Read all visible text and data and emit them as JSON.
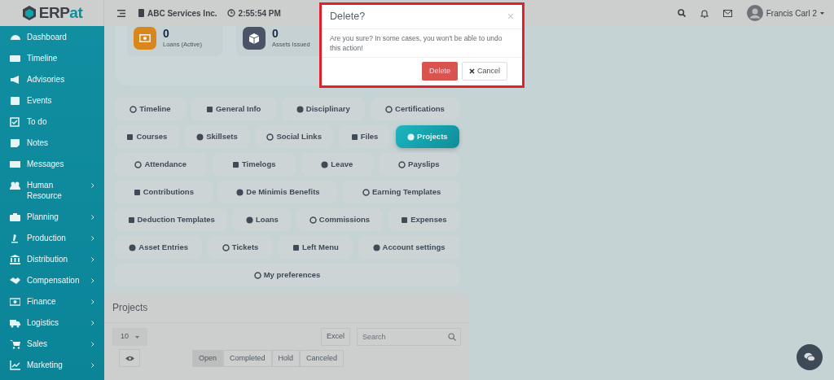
{
  "header": {
    "logo": {
      "main": "ERP",
      "accent": "at"
    },
    "company": "ABC Services Inc.",
    "time": "2:55:54 PM",
    "user": "Francis Carl 2"
  },
  "sidebar": {
    "items": [
      {
        "label": "Dashboard",
        "has_submenu": false
      },
      {
        "label": "Timeline",
        "has_submenu": false
      },
      {
        "label": "Advisories",
        "has_submenu": false
      },
      {
        "label": "Events",
        "has_submenu": false
      },
      {
        "label": "To do",
        "has_submenu": false
      },
      {
        "label": "Notes",
        "has_submenu": false
      },
      {
        "label": "Messages",
        "has_submenu": false
      },
      {
        "label": "Human Resource",
        "has_submenu": true
      },
      {
        "label": "Planning",
        "has_submenu": true
      },
      {
        "label": "Production",
        "has_submenu": true
      },
      {
        "label": "Distribution",
        "has_submenu": true
      },
      {
        "label": "Compensation",
        "has_submenu": true
      },
      {
        "label": "Finance",
        "has_submenu": true
      },
      {
        "label": "Logistics",
        "has_submenu": true
      },
      {
        "label": "Sales",
        "has_submenu": true
      },
      {
        "label": "Marketing",
        "has_submenu": true
      }
    ]
  },
  "stats": [
    {
      "value": "0",
      "label": "Loans (Active)",
      "color": "#d9861c"
    },
    {
      "value": "0",
      "label": "Assets Issued",
      "color": "#4a5466"
    }
  ],
  "profile_tabs": [
    [
      {
        "label": "Timeline",
        "selected": false
      },
      {
        "label": "General Info",
        "selected": false
      },
      {
        "label": "Disciplinary",
        "selected": false
      },
      {
        "label": "Certifications",
        "selected": false
      }
    ],
    [
      {
        "label": "Courses",
        "selected": false
      },
      {
        "label": "Skillsets",
        "selected": false
      },
      {
        "label": "Social Links",
        "selected": false
      },
      {
        "label": "Files",
        "selected": false
      },
      {
        "label": "Projects",
        "selected": true
      }
    ],
    [
      {
        "label": "Attendance",
        "selected": false
      },
      {
        "label": "Timelogs",
        "selected": false
      },
      {
        "label": "Leave",
        "selected": false
      },
      {
        "label": "Payslips",
        "selected": false
      }
    ],
    [
      {
        "label": "Contributions",
        "selected": false
      },
      {
        "label": "De Minimis Benefits",
        "selected": false
      },
      {
        "label": "Earning Templates",
        "selected": false
      }
    ],
    [
      {
        "label": "Deduction Templates",
        "selected": false
      },
      {
        "label": "Loans",
        "selected": false
      },
      {
        "label": "Commissions",
        "selected": false
      },
      {
        "label": "Expenses",
        "selected": false
      }
    ],
    [
      {
        "label": "Asset Entries",
        "selected": false
      },
      {
        "label": "Tickets",
        "selected": false
      },
      {
        "label": "Left Menu",
        "selected": false
      },
      {
        "label": "Account settings",
        "selected": false
      }
    ],
    [
      {
        "label": "My preferences",
        "selected": false
      }
    ]
  ],
  "projects": {
    "title": "Projects",
    "page_size": "10",
    "export_button": "Excel",
    "search": {
      "placeholder": "Search"
    },
    "status_tabs": [
      {
        "label": "Open",
        "selected": true
      },
      {
        "label": "Completed",
        "selected": false
      },
      {
        "label": "Hold",
        "selected": false
      },
      {
        "label": "Canceled",
        "selected": false
      }
    ]
  },
  "modal": {
    "title": "Delete?",
    "close": "×",
    "message": "Are you sure? In some cases, you won't be able to undo this action!",
    "confirm_button": "Delete",
    "cancel_button": "Cancel"
  }
}
